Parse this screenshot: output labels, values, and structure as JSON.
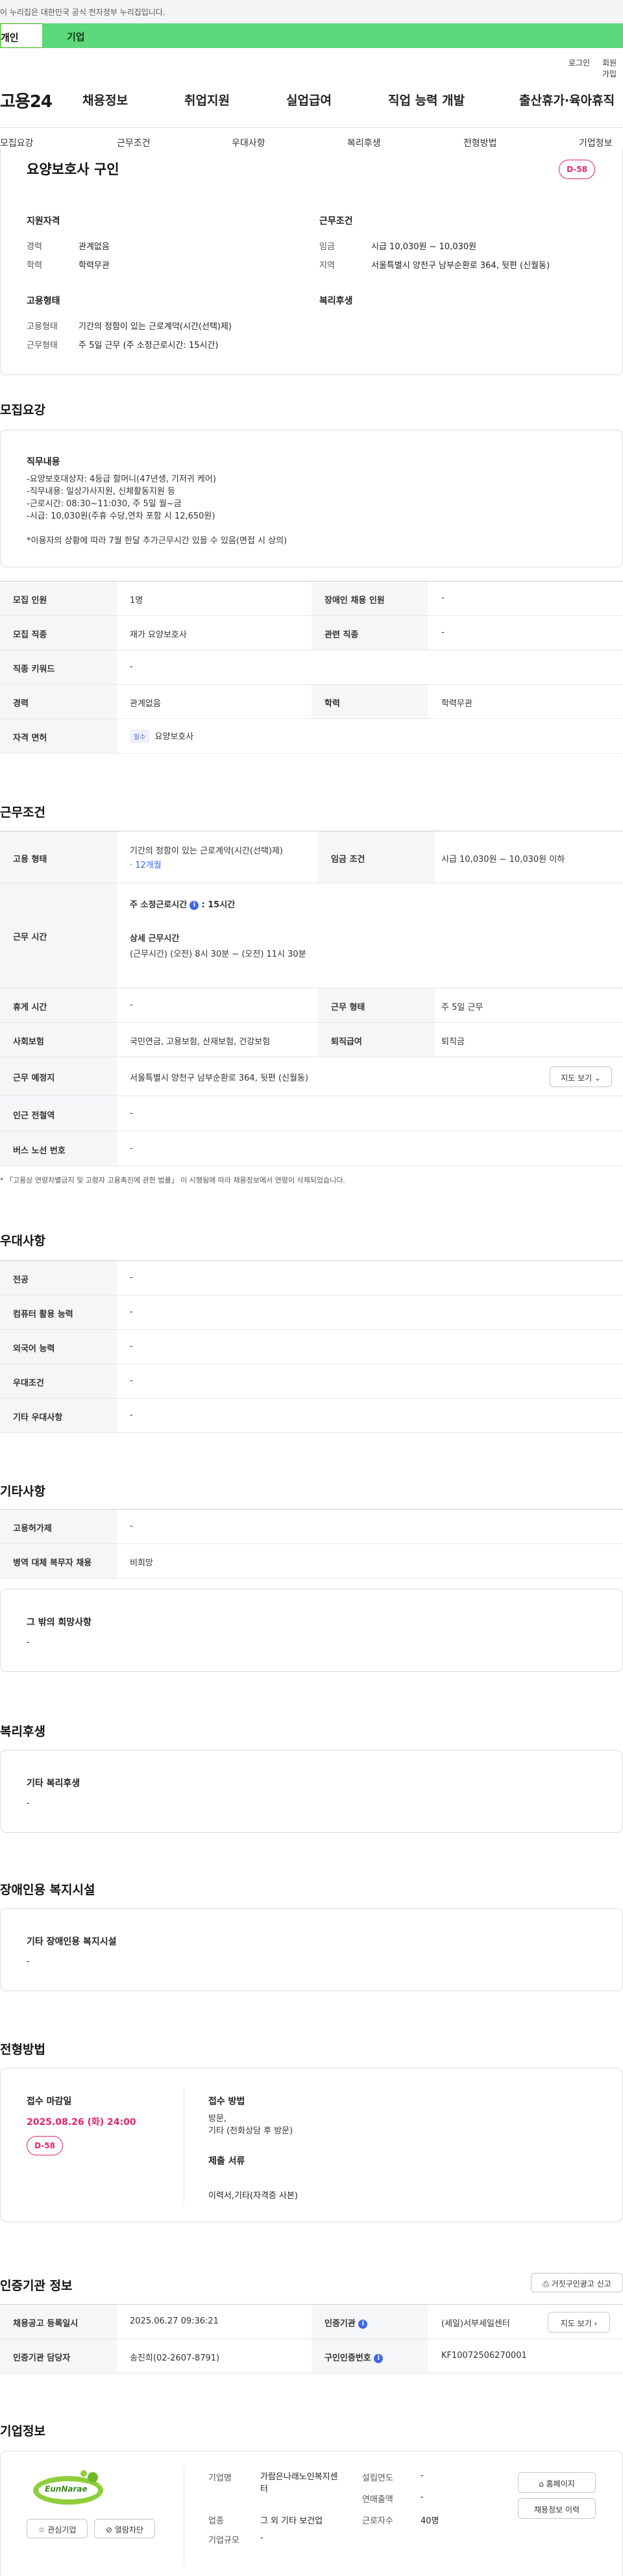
{
  "gov_banner": "이 누리집은 대한민국 공식 전자정부 누리집입니다.",
  "service_tabs": {
    "personal": "개인",
    "company": "기업"
  },
  "util_links": {
    "login": "로그인",
    "join": "회원가입"
  },
  "gnb": {
    "logo": "고용24",
    "items": [
      "채용정보",
      "취업지원",
      "실업급여",
      "직업 능력 개발",
      "출산휴가·육아휴직"
    ]
  },
  "section_tabs": [
    "모집요강",
    "근무조건",
    "우대사항",
    "복리후생",
    "전형방법",
    "기업정보"
  ],
  "summary": {
    "title": "요양보호사 구인",
    "dday": "D-58",
    "qual_heading": "지원자격",
    "qual": [
      {
        "label": "경력",
        "value": "관계없음"
      },
      {
        "label": "학력",
        "value": "학력무관"
      }
    ],
    "work_heading": "근무조건",
    "work": [
      {
        "label": "임금",
        "value": "시급 10,030원 ~ 10,030원"
      },
      {
        "label": "지역",
        "value": "서울특별시 양천구 남부순환로 364, 뒷편 (신월동)"
      }
    ],
    "emp_heading": "고용형태",
    "emp": [
      {
        "label": "고용형태",
        "value": "기간의 정함이 있는 근로계약(시간(선택)제)"
      },
      {
        "label": "근무형태",
        "value": "주 5일 근무 (주 소정근로시간: 15시간)"
      }
    ],
    "welfare_heading": "복리후생"
  },
  "recruit": {
    "heading": "모집요강",
    "duty_title": "직무내용",
    "duty_text": "-요양보호대상자: 4등급 할머니(47년생, 기저귀 케어)\n-직무내용: 일상가사지원, 신체활동지원 등\n-근로시간: 08:30~11:030, 주 5일 월~금\n-시급: 10,030원(주휴 수당,연차 포함 시 12,650원)\n\n*이용자의 상황에 따라 7월 한달 추가근무시간 있을 수 있음(면접 시 상의)",
    "rows": [
      {
        "th1": "모집 인원",
        "td1": "1명",
        "th2": "장애인 채용 인원",
        "td2": "-"
      },
      {
        "th1": "모집 직종",
        "td1": "재가 요양보호사",
        "th2": "관련 직종",
        "td2": "-"
      },
      {
        "th1": "직종 키워드",
        "td1": "-"
      },
      {
        "th1": "경력",
        "td1": "관계없음",
        "th2": "학력",
        "td2": "학력무관"
      },
      {
        "th1": "자격 면허",
        "badge": "필수",
        "td1": "요양보호사"
      }
    ]
  },
  "conditions": {
    "heading": "근무조건",
    "emp_label": "고용 형태",
    "emp_value": "기간의 정함이 있는 근로계약(시간(선택)제)",
    "emp_period": "· 12개월",
    "wage_label": "임금 조건",
    "wage_value": "시급 10,030원 ~ 10,030원 이하",
    "hours_label": "근무 시간",
    "hours_main": "주 소정근로시간",
    "hours_main_value": ": 15시간",
    "hours_detail_title": "상세 근무시간",
    "hours_detail": "(근무시간) (오전) 8시 30분 ~ (오전) 11시 30분",
    "rest_label": "휴게 시간",
    "rest_value": "-",
    "work_type_label": "근무 형태",
    "work_type_value": "주 5일 근무",
    "insurance_label": "사회보험",
    "insurance_value": "국민연금, 고용보험, 산재보험, 건강보험",
    "retire_label": "퇴직급여",
    "retire_value": "퇴직금",
    "place_label": "근무 예정지",
    "place_value": "서울특별시 양천구 남부순환로 364, 뒷편 (신월동)",
    "map_btn": "지도 보기",
    "station_label": "인근 전철역",
    "station_value": "-",
    "bus_label": "버스 노선 번호",
    "bus_value": "-",
    "note": "* 「고용상 연령차별금지 및 고령자 고용촉진에 관한 법률」 이 시행됨에 따라 채용정보에서 연령이 삭제되었습니다."
  },
  "preference": {
    "heading": "우대사항",
    "rows": [
      {
        "th": "전공",
        "td": "-"
      },
      {
        "th": "컴퓨터 활용 능력",
        "td": "-"
      },
      {
        "th": "외국어 능력",
        "td": "-"
      },
      {
        "th": "우대조건",
        "td": "-"
      },
      {
        "th": "기타 우대사항",
        "td": "-"
      }
    ]
  },
  "etc": {
    "heading": "기타사항",
    "rows": [
      {
        "th": "고용허가제",
        "td": "-"
      },
      {
        "th": "병역 대체 복무자 채용",
        "td": "비희망"
      }
    ],
    "box_title": "그 밖의 희망사항",
    "box_value": "-"
  },
  "welfare": {
    "heading": "복리후생",
    "box_title": "기타 복리후생",
    "box_value": "-"
  },
  "disability": {
    "heading": "장애인용 복지시설",
    "box_title": "기타 장애인용 복지시설",
    "box_value": "-"
  },
  "selection": {
    "heading": "전형방법",
    "deadline_title": "접수 마감일",
    "deadline": "2025.08.26 (화) 24:00",
    "dday": "D-58",
    "method_title": "접수 방법",
    "method": "방문,\n기타 (전화상담 후 방문)",
    "docs_title": "제출 서류",
    "docs": "이력서,기타(자격증 사본)"
  },
  "certification": {
    "heading": "인증기관 정보",
    "report_btn": "거짓구인광고 신고",
    "reg_label": "채용공고 등록일시",
    "reg_value": "2025.06.27 09:36:21",
    "org_label": "인증기관",
    "org_value": "(세일)서부세일센터",
    "map_btn": "지도 보기",
    "mgr_label": "인증기관 담당자",
    "mgr_value": "송진희(02-2607-8791)",
    "num_label": "구인인증번호",
    "num_value": "KF10072506270001"
  },
  "company": {
    "heading": "기업정보",
    "logo_text": "EunNarae",
    "interest_btn": "관심기업",
    "block_btn": "열람차단",
    "name_label": "기업명",
    "name_value": "가람은나래노인복지센터",
    "year_label": "설립연도",
    "year_value": "-",
    "sales_label": "연매출액",
    "sales_value": "-",
    "industry_label": "업종",
    "industry_value": "그 외 기타 보건업",
    "staff_label": "근로자수",
    "staff_value": "40명",
    "size_label": "기업규모",
    "size_value": "-",
    "homepage_btn": "홈페이지",
    "history_btn": "채용정보 이력"
  },
  "colors": {
    "accent_green": "#5dd87a",
    "dday_pink": "#e0256c",
    "info_blue": "#3f68e8"
  }
}
